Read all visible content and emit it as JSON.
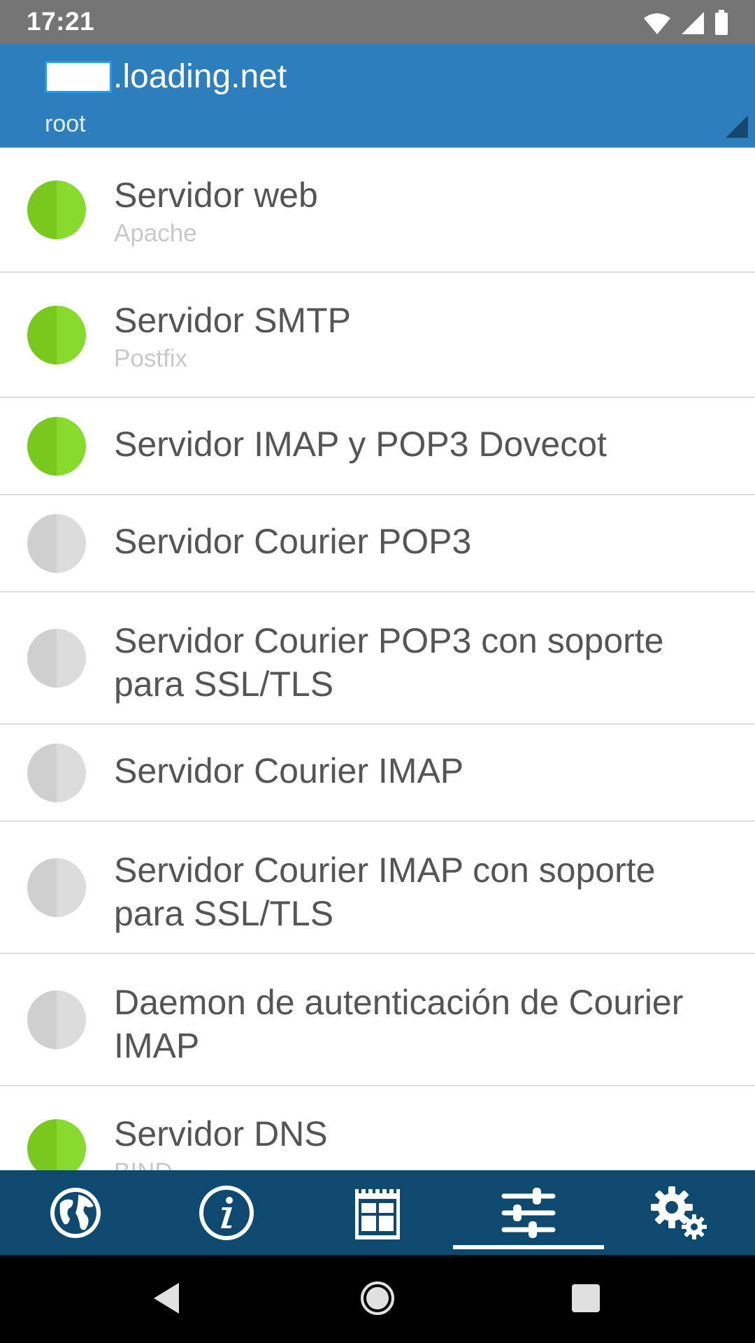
{
  "status_bar": {
    "time": "17:21",
    "icons": [
      "wifi-icon",
      "signal-icon",
      "battery-icon"
    ]
  },
  "header": {
    "host": ".loading.net",
    "user": "root"
  },
  "services": [
    {
      "name": "Servidor web",
      "detail": "Apache",
      "status": "on"
    },
    {
      "name": "Servidor SMTP",
      "detail": "Postfix",
      "status": "on"
    },
    {
      "name": "Servidor IMAP y POP3 Dovecot",
      "detail": "",
      "status": "on"
    },
    {
      "name": "Servidor Courier POP3",
      "detail": "",
      "status": "off"
    },
    {
      "name": "Servidor Courier POP3 con soporte para SSL/TLS",
      "detail": "",
      "status": "off"
    },
    {
      "name": "Servidor Courier IMAP",
      "detail": "",
      "status": "off"
    },
    {
      "name": "Servidor Courier IMAP con soporte para SSL/TLS",
      "detail": "",
      "status": "off"
    },
    {
      "name": "Daemon de autenticación de Courier IMAP",
      "detail": "",
      "status": "off"
    },
    {
      "name": "Servidor DNS",
      "detail": "BIND",
      "status": "on"
    }
  ],
  "bottom_nav": {
    "items": [
      "globe-icon",
      "info-icon",
      "dashboard-icon",
      "sliders-icon",
      "gears-icon"
    ],
    "active": "sliders-icon"
  },
  "colors": {
    "header": "#2c7fbc",
    "bottom_nav": "#0e4a70",
    "status_on": "#86db2c",
    "status_off": "#dcdcdc"
  }
}
